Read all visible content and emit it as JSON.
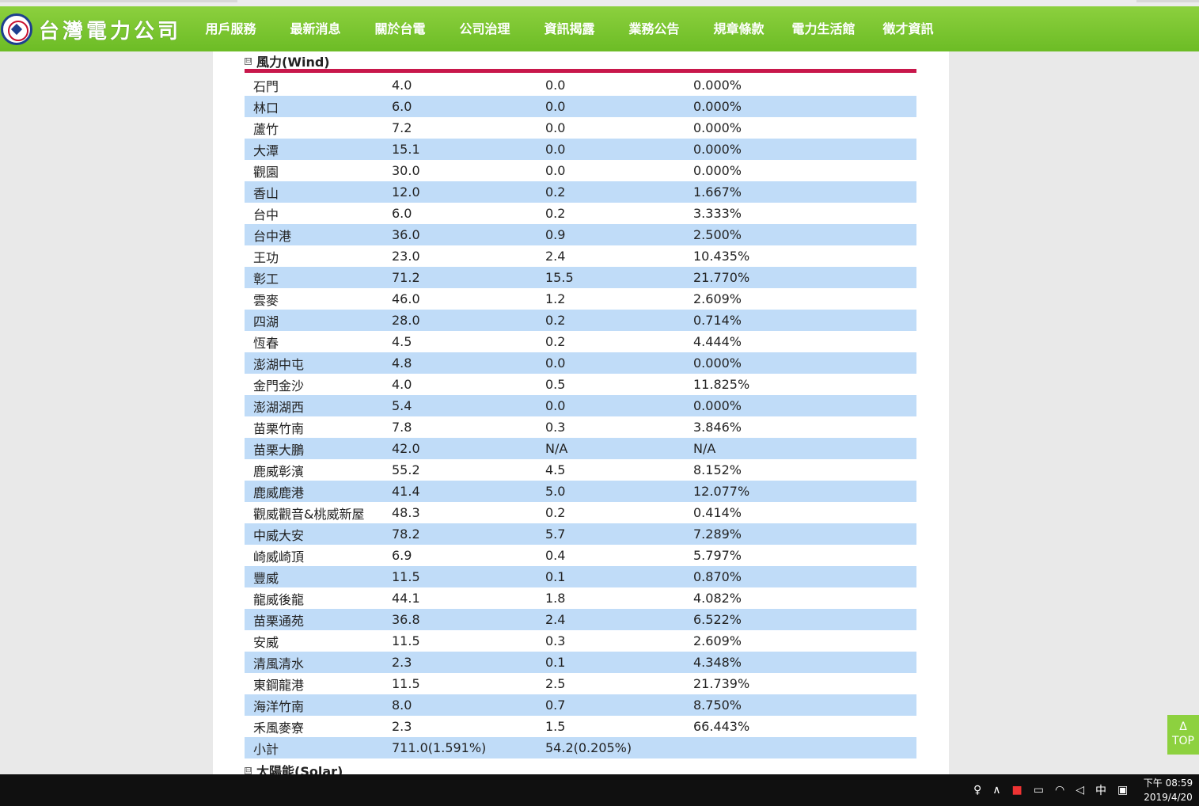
{
  "header": {
    "logo_text": "台灣電力公司",
    "nav": [
      "用戶服務",
      "最新消息",
      "關於台電",
      "公司治理",
      "資訊揭露",
      "業務公告",
      "規章條款",
      "電力生活館",
      "徵才資訊"
    ],
    "active_nav": "資訊揭露"
  },
  "wind_section": {
    "title": "風力(Wind)",
    "rows": [
      [
        "石門",
        "4.0",
        "0.0",
        "0.000%"
      ],
      [
        "林口",
        "6.0",
        "0.0",
        "0.000%"
      ],
      [
        "蘆竹",
        "7.2",
        "0.0",
        "0.000%"
      ],
      [
        "大潭",
        "15.1",
        "0.0",
        "0.000%"
      ],
      [
        "觀園",
        "30.0",
        "0.0",
        "0.000%"
      ],
      [
        "香山",
        "12.0",
        "0.2",
        "1.667%"
      ],
      [
        "台中",
        "6.0",
        "0.2",
        "3.333%"
      ],
      [
        "台中港",
        "36.0",
        "0.9",
        "2.500%"
      ],
      [
        "王功",
        "23.0",
        "2.4",
        "10.435%"
      ],
      [
        "彰工",
        "71.2",
        "15.5",
        "21.770%"
      ],
      [
        "雲麥",
        "46.0",
        "1.2",
        "2.609%"
      ],
      [
        "四湖",
        "28.0",
        "0.2",
        "0.714%"
      ],
      [
        "恆春",
        "4.5",
        "0.2",
        "4.444%"
      ],
      [
        "澎湖中屯",
        "4.8",
        "0.0",
        "0.000%"
      ],
      [
        "金門金沙",
        "4.0",
        "0.5",
        "11.825%"
      ],
      [
        "澎湖湖西",
        "5.4",
        "0.0",
        "0.000%"
      ],
      [
        "苗栗竹南",
        "7.8",
        "0.3",
        "3.846%"
      ],
      [
        "苗栗大鵬",
        "42.0",
        "N/A",
        "N/A"
      ],
      [
        "鹿威彰濱",
        "55.2",
        "4.5",
        "8.152%"
      ],
      [
        "鹿威鹿港",
        "41.4",
        "5.0",
        "12.077%"
      ],
      [
        "觀威觀音&桃威新屋",
        "48.3",
        "0.2",
        "0.414%"
      ],
      [
        "中威大安",
        "78.2",
        "5.7",
        "7.289%"
      ],
      [
        "崎威崎頂",
        "6.9",
        "0.4",
        "5.797%"
      ],
      [
        "豐威",
        "11.5",
        "0.1",
        "0.870%"
      ],
      [
        "龍威後龍",
        "44.1",
        "1.8",
        "4.082%"
      ],
      [
        "苗栗通苑",
        "36.8",
        "2.4",
        "6.522%"
      ],
      [
        "安威",
        "11.5",
        "0.3",
        "2.609%"
      ],
      [
        "清風清水",
        "2.3",
        "0.1",
        "4.348%"
      ],
      [
        "東鋼龍港",
        "11.5",
        "2.5",
        "21.739%"
      ],
      [
        "海洋竹南",
        "8.0",
        "0.7",
        "8.750%"
      ],
      [
        "禾風麥寮",
        "2.3",
        "1.5",
        "66.443%"
      ],
      [
        "小計",
        "711.0(1.591%)",
        "54.2(0.205%)",
        ""
      ]
    ]
  },
  "solar_section": {
    "title": "太陽能(Solar)"
  },
  "collapse_glyph": "⊟",
  "top_button": {
    "arrow": "Δ",
    "label": "TOP"
  },
  "taskbar": {
    "ime": "中",
    "time": "下午 08:59",
    "date": "2019/4/20"
  },
  "colors": {
    "nav_green": "#7cc530",
    "accent_red": "#c8174b",
    "row_alt_blue": "#c0dcf8"
  }
}
